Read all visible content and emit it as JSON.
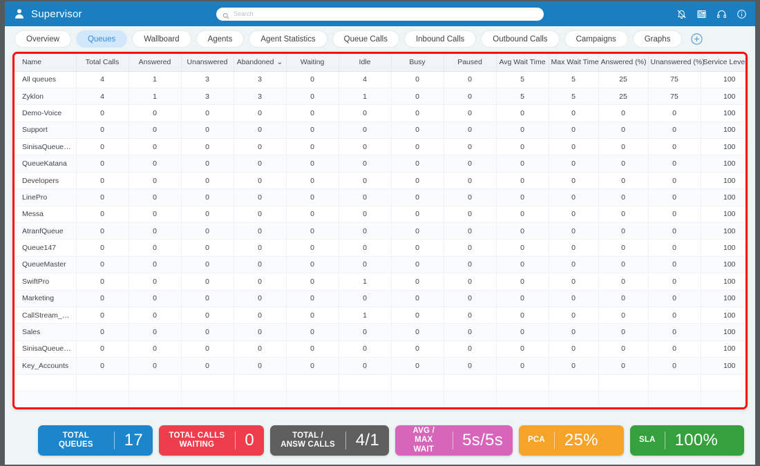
{
  "topbar": {
    "title": "Supervisor",
    "user_icon": "user-icon",
    "search": {
      "value": "",
      "placeholder": "Search"
    },
    "icons": [
      "bell-mute-icon",
      "desk-phone-icon",
      "headset-icon",
      "info-circle-icon"
    ]
  },
  "tabs": [
    {
      "label": "Overview",
      "active": false
    },
    {
      "label": "Queues",
      "active": true
    },
    {
      "label": "Wallboard",
      "active": false
    },
    {
      "label": "Agents",
      "active": false
    },
    {
      "label": "Agent Statistics",
      "active": false
    },
    {
      "label": "Queue Calls",
      "active": false
    },
    {
      "label": "Inbound Calls",
      "active": false
    },
    {
      "label": "Outbound Calls",
      "active": false
    },
    {
      "label": "Campaigns",
      "active": false
    },
    {
      "label": "Graphs",
      "active": false
    }
  ],
  "add_tab_label": "+",
  "table": {
    "columns": [
      "Name",
      "Total Calls",
      "Answered",
      "Unanswered",
      "Abandoned",
      "Waiting",
      "Idle",
      "Busy",
      "Paused",
      "Avg Wait Time",
      "Max Wait Time",
      "Answered (%)",
      "Unanswered (%)",
      "Service Level (%)"
    ],
    "sorted_column": "Abandoned",
    "sort_caret": "⌄",
    "rows": [
      [
        "All queues",
        "4",
        "1",
        "3",
        "3",
        "0",
        "4",
        "0",
        "0",
        "5",
        "5",
        "25",
        "75",
        "100"
      ],
      [
        "Zyklon",
        "4",
        "1",
        "3",
        "3",
        "0",
        "1",
        "0",
        "0",
        "5",
        "5",
        "25",
        "75",
        "100"
      ],
      [
        "Demo-Voice",
        "0",
        "0",
        "0",
        "0",
        "0",
        "0",
        "0",
        "0",
        "0",
        "0",
        "0",
        "0",
        "100"
      ],
      [
        "Support",
        "0",
        "0",
        "0",
        "0",
        "0",
        "0",
        "0",
        "0",
        "0",
        "0",
        "0",
        "0",
        "100"
      ],
      [
        "SinisaQueue_…",
        "0",
        "0",
        "0",
        "0",
        "0",
        "0",
        "0",
        "0",
        "0",
        "0",
        "0",
        "0",
        "100"
      ],
      [
        "QueueKatana",
        "0",
        "0",
        "0",
        "0",
        "0",
        "0",
        "0",
        "0",
        "0",
        "0",
        "0",
        "0",
        "100"
      ],
      [
        "Developers",
        "0",
        "0",
        "0",
        "0",
        "0",
        "0",
        "0",
        "0",
        "0",
        "0",
        "0",
        "0",
        "100"
      ],
      [
        "LinePro",
        "0",
        "0",
        "0",
        "0",
        "0",
        "0",
        "0",
        "0",
        "0",
        "0",
        "0",
        "0",
        "100"
      ],
      [
        "Messa",
        "0",
        "0",
        "0",
        "0",
        "0",
        "0",
        "0",
        "0",
        "0",
        "0",
        "0",
        "0",
        "100"
      ],
      [
        "AtranfQueue",
        "0",
        "0",
        "0",
        "0",
        "0",
        "0",
        "0",
        "0",
        "0",
        "0",
        "0",
        "0",
        "100"
      ],
      [
        "Queue147",
        "0",
        "0",
        "0",
        "0",
        "0",
        "0",
        "0",
        "0",
        "0",
        "0",
        "0",
        "0",
        "100"
      ],
      [
        "QueueMaster",
        "0",
        "0",
        "0",
        "0",
        "0",
        "0",
        "0",
        "0",
        "0",
        "0",
        "0",
        "0",
        "100"
      ],
      [
        "SwiftPro",
        "0",
        "0",
        "0",
        "0",
        "0",
        "1",
        "0",
        "0",
        "0",
        "0",
        "0",
        "0",
        "100"
      ],
      [
        "Marketing",
        "0",
        "0",
        "0",
        "0",
        "0",
        "0",
        "0",
        "0",
        "0",
        "0",
        "0",
        "0",
        "100"
      ],
      [
        "CallStream_Q…",
        "0",
        "0",
        "0",
        "0",
        "0",
        "1",
        "0",
        "0",
        "0",
        "0",
        "0",
        "0",
        "100"
      ],
      [
        "Sales",
        "0",
        "0",
        "0",
        "0",
        "0",
        "0",
        "0",
        "0",
        "0",
        "0",
        "0",
        "0",
        "100"
      ],
      [
        "SinisaQueue_…",
        "0",
        "0",
        "0",
        "0",
        "0",
        "0",
        "0",
        "0",
        "0",
        "0",
        "0",
        "0",
        "100"
      ],
      [
        "Key_Accounts",
        "0",
        "0",
        "0",
        "0",
        "0",
        "0",
        "0",
        "0",
        "0",
        "0",
        "0",
        "0",
        "100"
      ],
      [
        "",
        "",
        "",
        "",
        "",
        "",
        "",
        "",
        "",
        "",
        "",
        "",
        "",
        ""
      ],
      [
        "",
        "",
        "",
        "",
        "",
        "",
        "",
        "",
        "",
        "",
        "",
        "",
        "",
        ""
      ]
    ]
  },
  "stats": [
    {
      "label": "TOTAL QUEUES",
      "value": "17",
      "color": "#1b86cb",
      "key": "total-queues"
    },
    {
      "label": "TOTAL CALLS WAITING",
      "value": "0",
      "color": "#ee3d4c",
      "key": "total-calls-waiting"
    },
    {
      "label": "TOTAL / ANSW CALLS",
      "value": "4/1",
      "color": "#5f5f5f",
      "key": "total-answered-calls"
    },
    {
      "label": "AVG / MAX WAIT",
      "value": "5s/5s",
      "color": "#d766bb",
      "key": "avg-max-wait"
    },
    {
      "label": "PCA",
      "value": "25%",
      "color": "#f6a429",
      "key": "pca"
    },
    {
      "label": "SLA",
      "value": "100%",
      "color": "#37a03e",
      "key": "sla"
    }
  ],
  "accent_colors": {
    "topbar": "#1a7fc1",
    "active_tab_bg": "#d3e7fb",
    "active_tab_text": "#2d8fe0",
    "highlight_border": "#fb0d0d",
    "page_bg": "#eef5f4"
  }
}
